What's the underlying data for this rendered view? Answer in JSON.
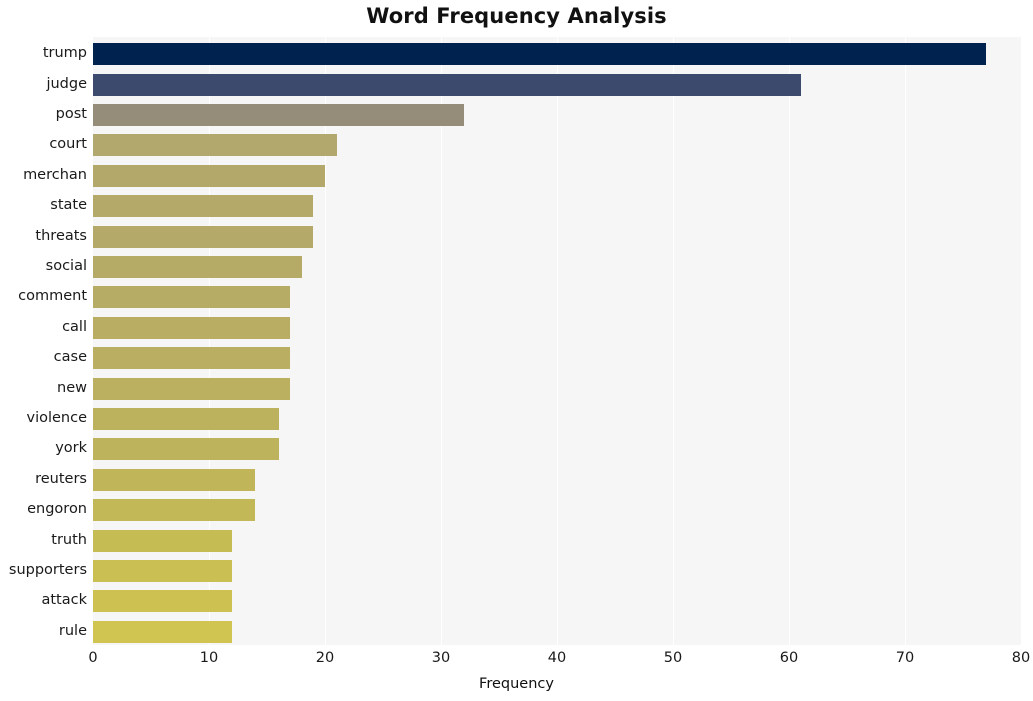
{
  "chart_data": {
    "type": "bar",
    "orientation": "horizontal",
    "title": "Word Frequency Analysis",
    "xlabel": "Frequency",
    "ylabel": "",
    "xlim": [
      0,
      80
    ],
    "ylim": null,
    "grid": true,
    "grid_axis": "x",
    "legend": false,
    "legend_position": "none",
    "xticks": [
      0,
      10,
      20,
      30,
      40,
      50,
      60,
      70,
      80
    ],
    "xtick_labels": [
      "0",
      "10",
      "20",
      "30",
      "40",
      "50",
      "60",
      "70",
      "80"
    ],
    "categories": [
      "trump",
      "judge",
      "post",
      "court",
      "merchan",
      "state",
      "threats",
      "social",
      "comment",
      "call",
      "case",
      "new",
      "violence",
      "york",
      "reuters",
      "engoron",
      "truth",
      "supporters",
      "attack",
      "rule"
    ],
    "values": [
      77,
      61,
      32,
      21,
      20,
      19,
      19,
      18,
      17,
      17,
      17,
      17,
      16,
      16,
      14,
      14,
      12,
      12,
      12,
      12
    ],
    "bar_colors": [
      "#00224e",
      "#3c4a6d",
      "#958d79",
      "#b2a76c",
      "#b3a86a",
      "#b4a968",
      "#b4a968",
      "#b6ab66",
      "#b7ac65",
      "#b8ad63",
      "#b9ae62",
      "#bab060",
      "#bcb25e",
      "#bdb35c",
      "#c0b659",
      "#c2b857",
      "#c6bc54",
      "#c9bf52",
      "#cdc251",
      "#d0c551"
    ],
    "plot_background": "#f6f6f6",
    "figure_background": "#ffffff",
    "gridline_color": "#ffffff",
    "title_color": "#111111",
    "tick_label_color": "#1a1a1a"
  }
}
